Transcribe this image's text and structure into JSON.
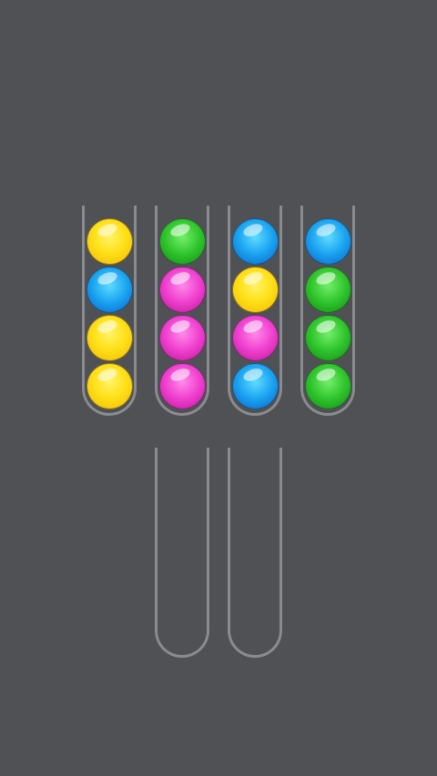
{
  "game": {
    "background": "#505155",
    "tube_stroke": "#8a8b90",
    "colors": {
      "yellow": "#ffe11a",
      "blue": "#1aa3f0",
      "green": "#2fc52c",
      "pink": "#f03fcf"
    },
    "tubes": [
      {
        "balls": [
          "yellow",
          "blue",
          "yellow",
          "yellow"
        ]
      },
      {
        "balls": [
          "green",
          "pink",
          "pink",
          "pink"
        ]
      },
      {
        "balls": [
          "blue",
          "yellow",
          "pink",
          "blue"
        ]
      },
      {
        "balls": [
          "blue",
          "green",
          "green",
          "green"
        ]
      },
      {
        "balls": []
      },
      {
        "balls": []
      }
    ]
  }
}
